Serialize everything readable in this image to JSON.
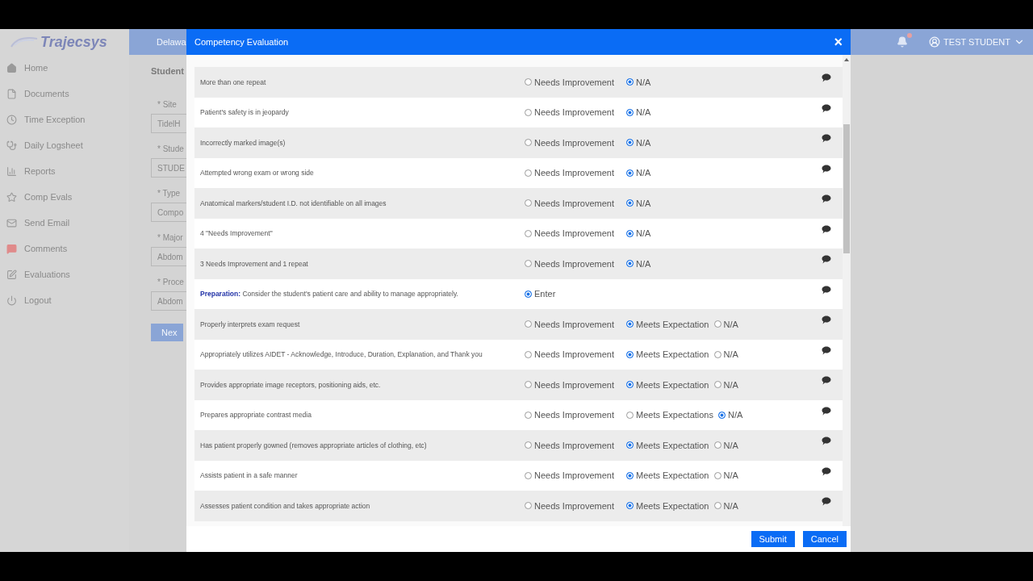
{
  "app": {
    "logo": "Trajecsys",
    "nav": [
      {
        "label": "Home"
      },
      {
        "label": "Documents"
      },
      {
        "label": "Time Exception"
      },
      {
        "label": "Daily Logsheet"
      },
      {
        "label": "Reports"
      },
      {
        "label": "Comp Evals"
      },
      {
        "label": "Send Email"
      },
      {
        "label": "Comments"
      },
      {
        "label": "Evaluations"
      },
      {
        "label": "Logout"
      }
    ],
    "header": {
      "org": "Delawa",
      "user": "TEST STUDENT"
    },
    "page": {
      "title": "Student",
      "fields": [
        {
          "label": "* Site",
          "value": "TidelH"
        },
        {
          "label": "* Stude",
          "value": "STUDE"
        },
        {
          "label": "* Type",
          "value": "Compo"
        },
        {
          "label": "* Major",
          "value": "Abdom"
        },
        {
          "label": "* Proce",
          "value": "Abdom"
        }
      ],
      "button": "Nex"
    }
  },
  "modal": {
    "title": "Competency Evaluation",
    "close": "×",
    "rows": [
      {
        "kind": "item",
        "label": "More than one repeat",
        "options": [
          {
            "label": "Needs Improvement",
            "selected": false
          },
          {
            "label": "N/A",
            "selected": true
          }
        ]
      },
      {
        "kind": "item",
        "label": "Patient's safety is in jeopardy",
        "options": [
          {
            "label": "Needs Improvement",
            "selected": false
          },
          {
            "label": "N/A",
            "selected": true
          }
        ]
      },
      {
        "kind": "item",
        "label": "Incorrectly marked image(s)",
        "options": [
          {
            "label": "Needs Improvement",
            "selected": false
          },
          {
            "label": "N/A",
            "selected": true
          }
        ]
      },
      {
        "kind": "item",
        "label": "Attempted wrong exam or wrong side",
        "options": [
          {
            "label": "Needs Improvement",
            "selected": false
          },
          {
            "label": "N/A",
            "selected": true
          }
        ]
      },
      {
        "kind": "item",
        "label": "Anatomical markers/student I.D. not identifiable on all images",
        "options": [
          {
            "label": "Needs Improvement",
            "selected": false
          },
          {
            "label": "N/A",
            "selected": true
          }
        ]
      },
      {
        "kind": "item",
        "label": "4 \"Needs Improvement\"",
        "options": [
          {
            "label": "Needs Improvement",
            "selected": false
          },
          {
            "label": "N/A",
            "selected": true
          }
        ]
      },
      {
        "kind": "item",
        "label": "3 Needs Improvement and 1 repeat",
        "options": [
          {
            "label": "Needs Improvement",
            "selected": false
          },
          {
            "label": "N/A",
            "selected": true
          }
        ]
      },
      {
        "kind": "section",
        "title": "Preparation:",
        "label": "Consider the student's patient care and ability to manage appropriately.",
        "options": [
          {
            "label": "Enter",
            "selected": true
          }
        ]
      },
      {
        "kind": "item",
        "label": "Properly interprets exam request",
        "options": [
          {
            "label": "Needs Improvement",
            "selected": false
          },
          {
            "label": "Meets Expectation",
            "selected": true
          },
          {
            "label": "N/A",
            "selected": false
          }
        ]
      },
      {
        "kind": "item",
        "label": "Appropriately utilizes AIDET - Acknowledge, Introduce, Duration, Explanation, and Thank you",
        "options": [
          {
            "label": "Needs Improvement",
            "selected": false
          },
          {
            "label": "Meets Expectation",
            "selected": true
          },
          {
            "label": "N/A",
            "selected": false
          }
        ]
      },
      {
        "kind": "item",
        "label": "Provides appropriate image receptors, positioning aids, etc.",
        "options": [
          {
            "label": "Needs Improvement",
            "selected": false
          },
          {
            "label": "Meets Expectation",
            "selected": true
          },
          {
            "label": "N/A",
            "selected": false
          }
        ]
      },
      {
        "kind": "item",
        "label": "Prepares appropriate contrast media",
        "options": [
          {
            "label": "Needs Improvement",
            "selected": false
          },
          {
            "label": "Meets Expectations",
            "selected": false
          },
          {
            "label": "N/A",
            "selected": true
          }
        ]
      },
      {
        "kind": "item",
        "label": "Has patient properly gowned (removes appropriate articles of clothing, etc)",
        "options": [
          {
            "label": "Needs Improvement",
            "selected": false
          },
          {
            "label": "Meets Expectation",
            "selected": true
          },
          {
            "label": "N/A",
            "selected": false
          }
        ]
      },
      {
        "kind": "item",
        "label": "Assists patient in a safe manner",
        "options": [
          {
            "label": "Needs Improvement",
            "selected": false
          },
          {
            "label": "Meets Expectation",
            "selected": true
          },
          {
            "label": "N/A",
            "selected": false
          }
        ]
      },
      {
        "kind": "item",
        "label": "Assesses patient condition and takes appropriate action",
        "options": [
          {
            "label": "Needs Improvement",
            "selected": false
          },
          {
            "label": "Meets Expectation",
            "selected": true
          },
          {
            "label": "N/A",
            "selected": false
          }
        ]
      }
    ],
    "buttons": [
      {
        "label": "Submit"
      },
      {
        "label": "Cancel"
      }
    ]
  }
}
